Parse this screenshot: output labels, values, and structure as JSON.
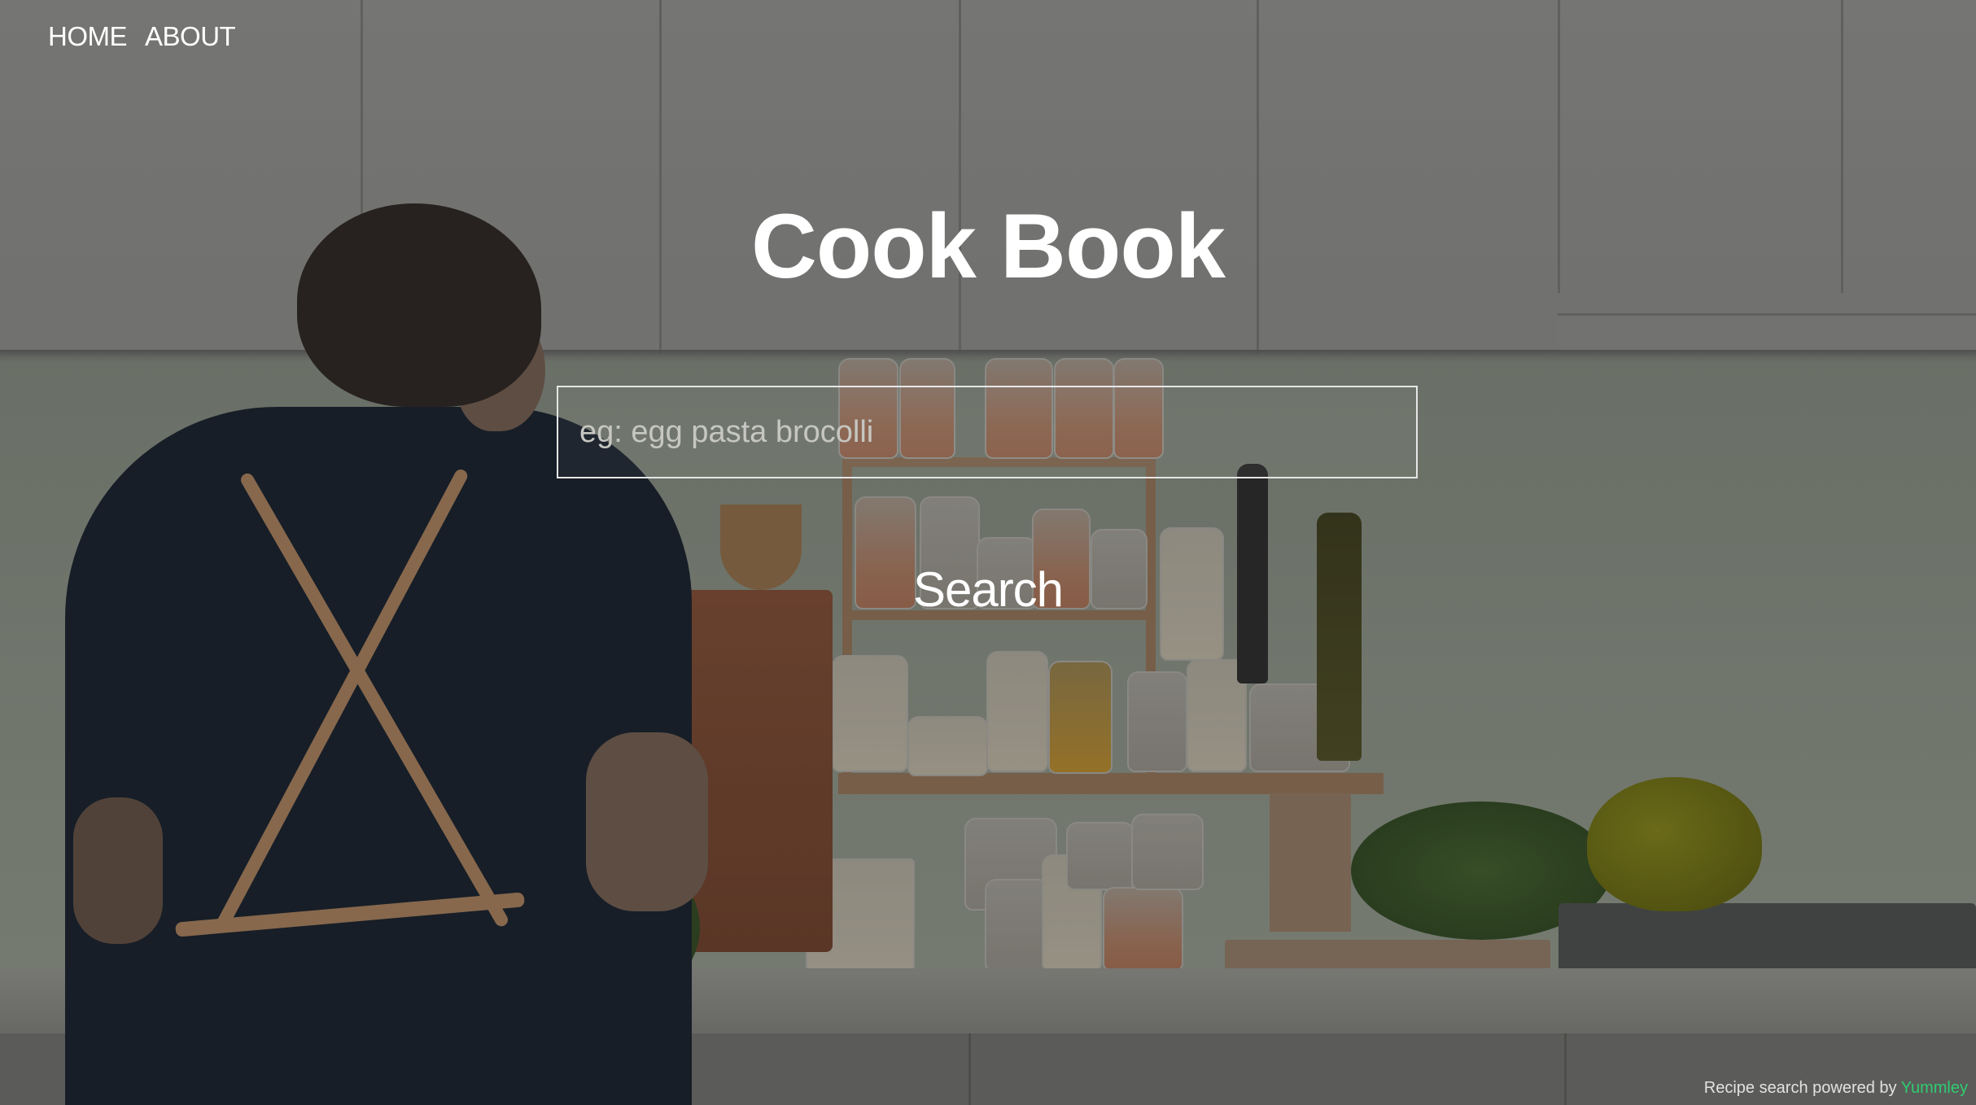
{
  "nav": {
    "items": [
      {
        "label": "HOME"
      },
      {
        "label": "ABOUT"
      }
    ]
  },
  "hero": {
    "title": "Cook Book"
  },
  "search": {
    "placeholder": "eg: egg pasta brocolli",
    "value": "",
    "button_label": "Search"
  },
  "footer": {
    "credit_prefix": "Recipe search powered by",
    "credit_brand": "Yummley"
  },
  "colors": {
    "text": "#ffffff",
    "brand_link": "#2ecc71",
    "input_border": "#e6e6e6"
  }
}
